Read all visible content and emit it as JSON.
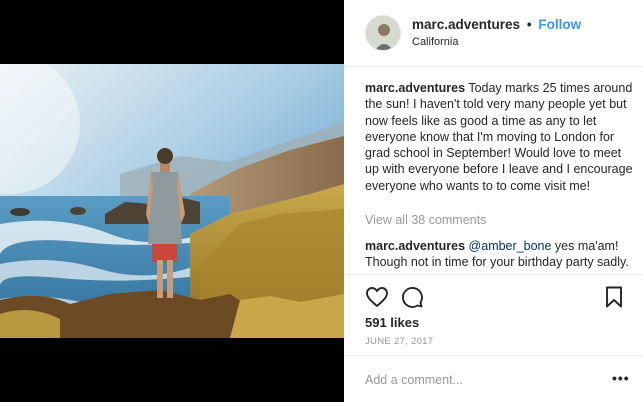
{
  "post": {
    "username": "marc.adventures",
    "separator": "•",
    "follow_label": "Follow",
    "location": "California",
    "caption": "Today marks 25 times around the sun! I haven't told very many people yet but now feels like as good a time as any to let everyone know that I'm moving to London for grad school in September! Would love to meet up with everyone before I leave and I encourage everyone who wants to to come visit me!",
    "view_all_comments": "View all 38 comments",
    "comments": [
      {
        "username": "marc.adventures",
        "mention": "@amber_bone",
        "text": "yes ma'am! Though not in time for your birthday party sadly. Hopefully soon still"
      }
    ],
    "likes": "591 likes",
    "date": "JUNE 27, 2017",
    "comment_placeholder": "Add a comment...",
    "more_label": "•••"
  },
  "icons": {
    "like": "heart-icon",
    "comment": "comment-bubble-icon",
    "save": "bookmark-icon",
    "avatar": "avatar"
  },
  "colors": {
    "follow": "#3897f0",
    "muted": "#999999",
    "text": "#262626",
    "mention": "#003569"
  }
}
